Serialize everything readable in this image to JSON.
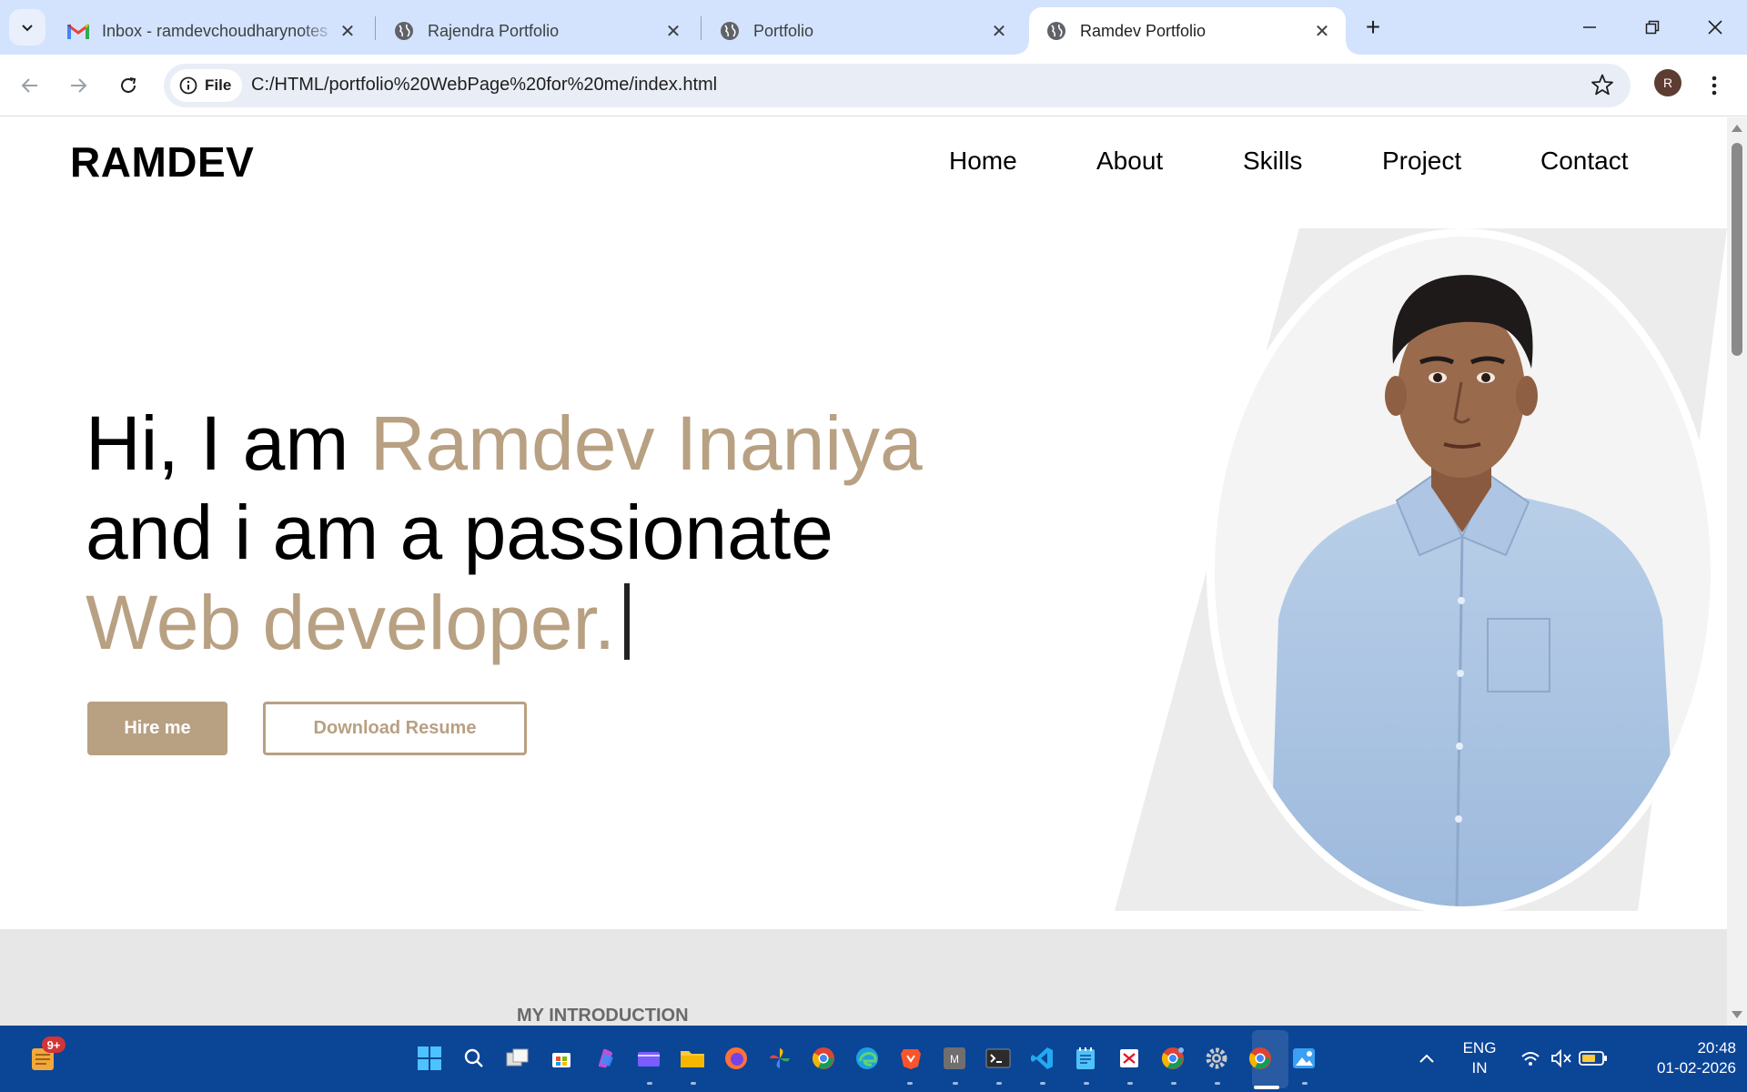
{
  "browser": {
    "tabs": [
      {
        "title": "Inbox - ramdevchoudharynotes",
        "icon": "gmail-icon",
        "active": false
      },
      {
        "title": "Rajendra Portfolio",
        "icon": "globe-icon",
        "active": false
      },
      {
        "title": "Portfolio",
        "icon": "globe-icon",
        "active": false
      },
      {
        "title": "Ramdev Portfolio",
        "icon": "globe-icon",
        "active": true
      }
    ],
    "new_tab": "+",
    "site_chip": "File",
    "url": "C:/HTML/portfolio%20WebPage%20for%20me/index.html",
    "profile_initial": "R"
  },
  "site": {
    "brand": "RAMDEV",
    "nav": [
      "Home",
      "About",
      "Skills",
      "Project",
      "Contact"
    ],
    "hero": {
      "line1_plain": "Hi, I am ",
      "line1_accent": "Ramdev Inaniya",
      "line2": "and i am a passionate",
      "line3_accent": "Web developer."
    },
    "buttons": {
      "hire": "Hire me",
      "resume": "Download Resume"
    },
    "intro_label": "MY INTRODUCTION",
    "accent_color": "#b8a082"
  },
  "taskbar": {
    "widget_badge": "9+",
    "language": [
      "ENG",
      "IN"
    ],
    "time": "20:48",
    "date": "01-02-2026"
  }
}
